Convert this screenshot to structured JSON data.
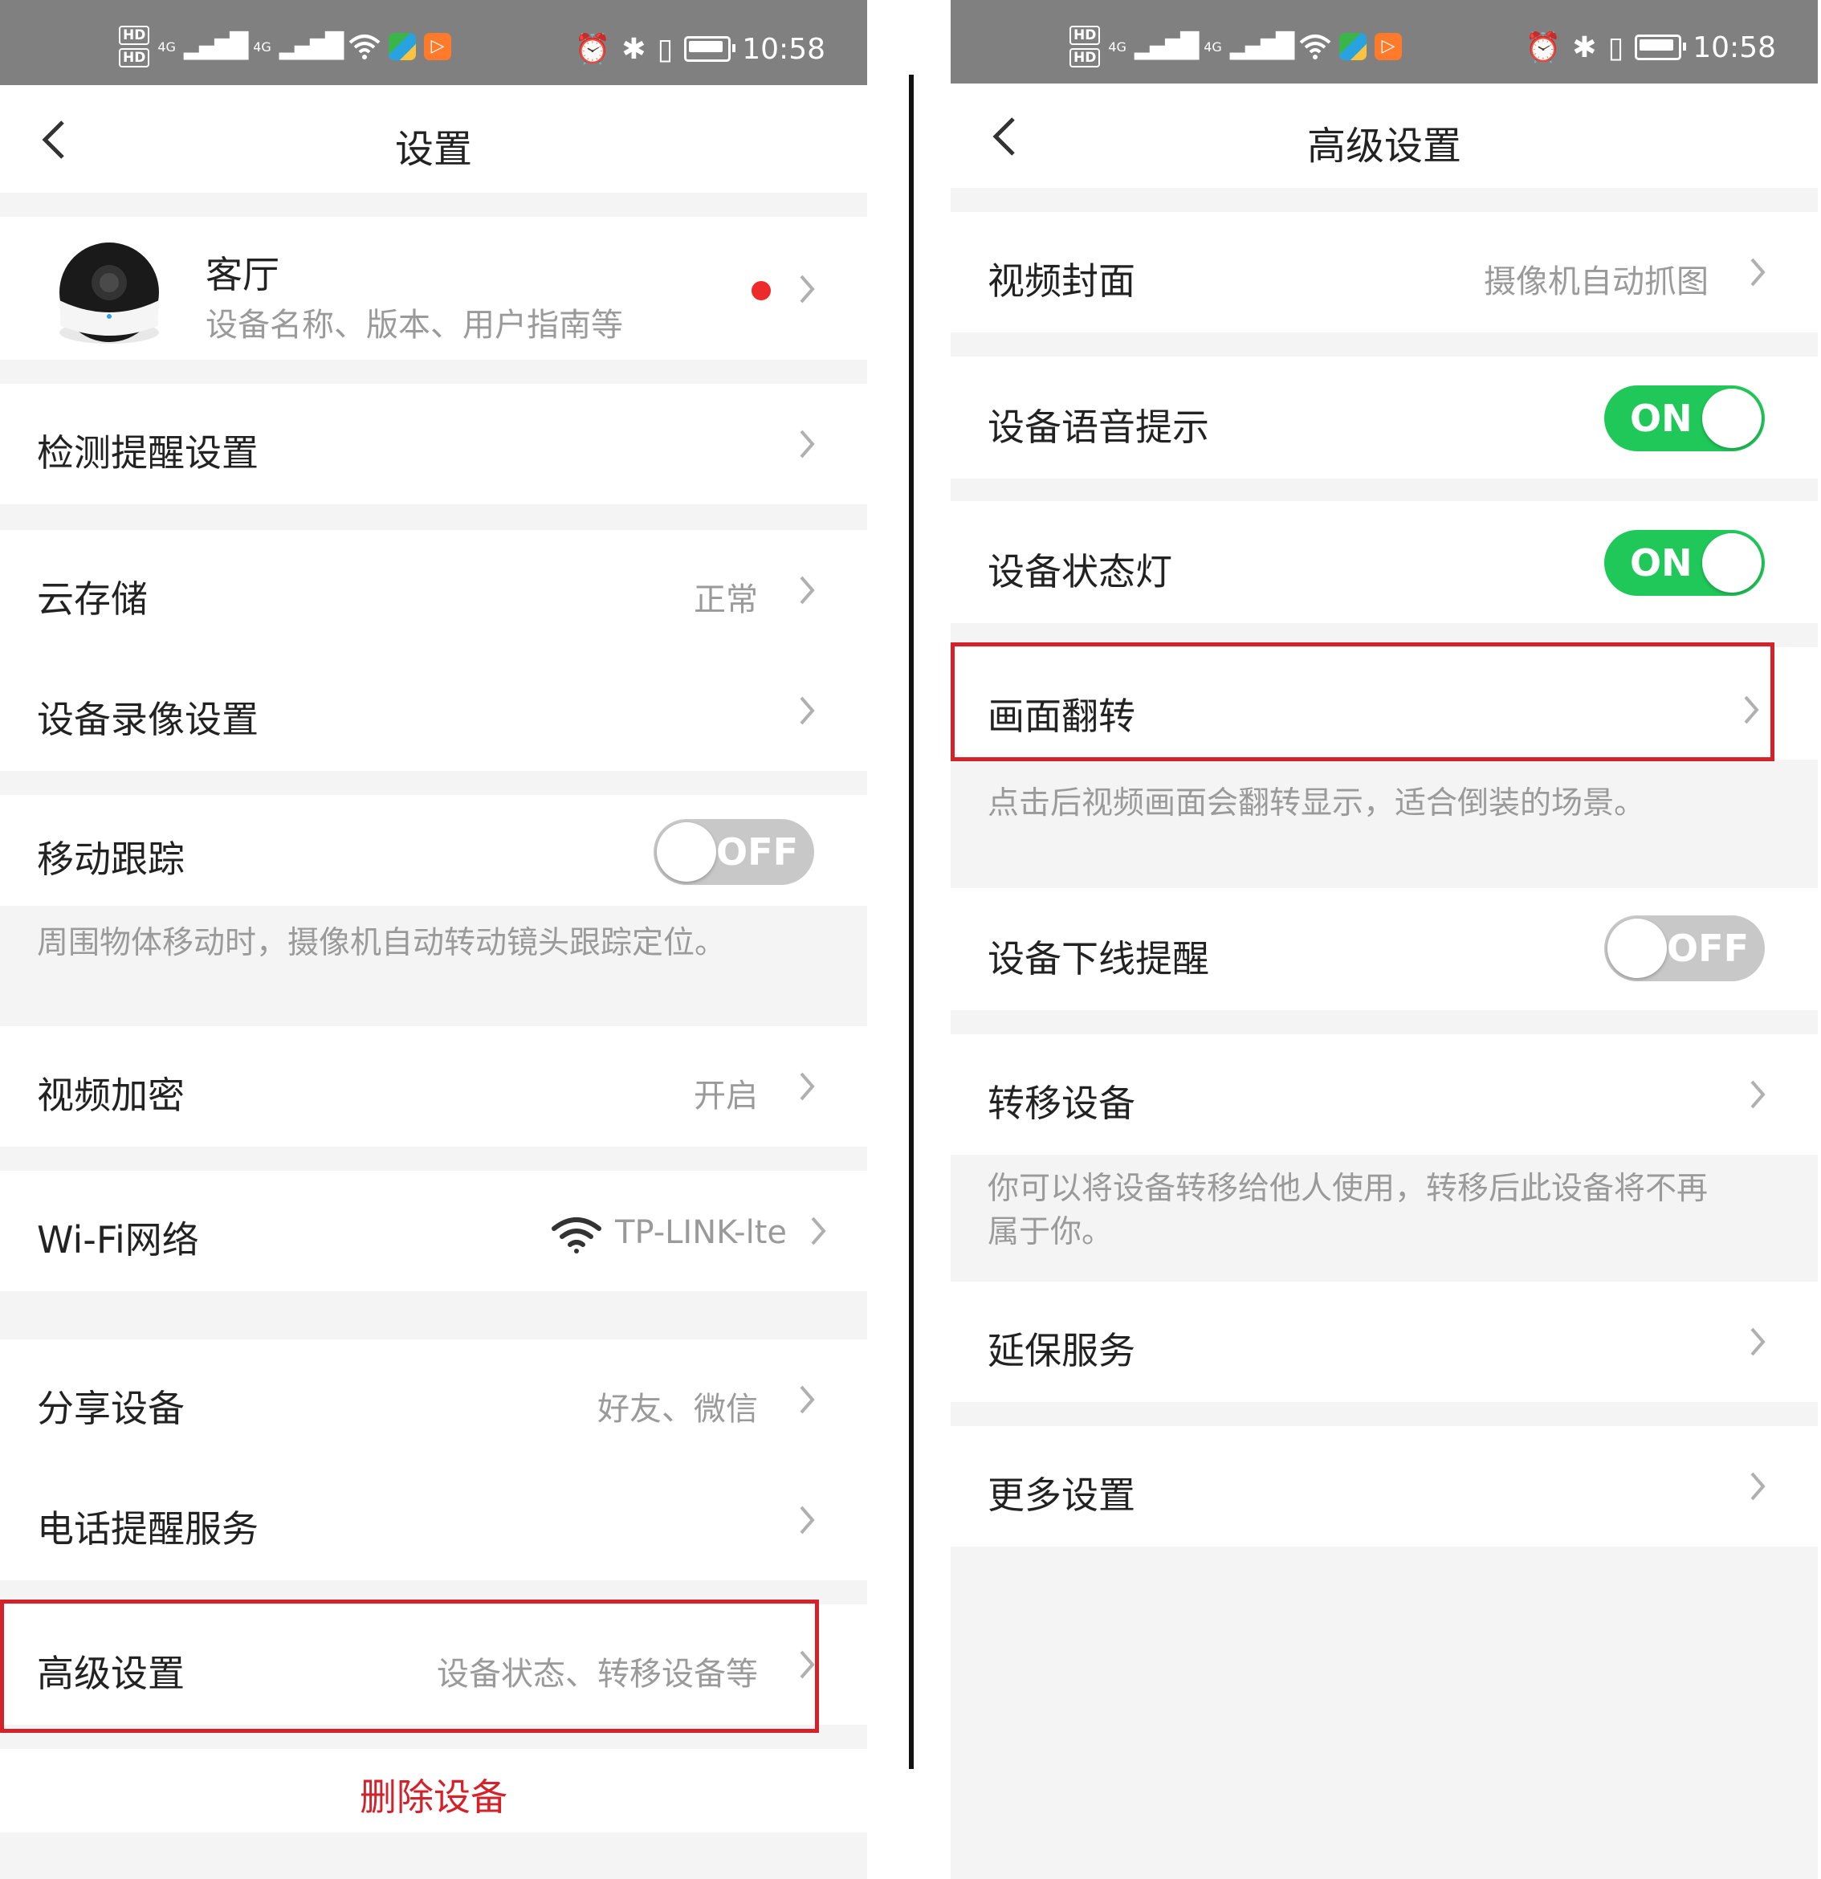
{
  "status_bar": {
    "hd1": "HD",
    "hd2": "HD",
    "net1": "4G",
    "net2": "4G",
    "time": "10:58"
  },
  "left": {
    "title": "设置",
    "device": {
      "name": "客厅",
      "subtitle": "设备名称、版本、用户指南等"
    },
    "items": {
      "detection": {
        "label": "检测提醒设置"
      },
      "cloud": {
        "label": "云存储",
        "value": "正常"
      },
      "recording": {
        "label": "设备录像设置"
      },
      "tracking": {
        "label": "移动跟踪",
        "toggle": "OFF",
        "hint": "周围物体移动时，摄像机自动转动镜头跟踪定位。"
      },
      "encryption": {
        "label": "视频加密",
        "value": "开启"
      },
      "wifi": {
        "label": "Wi-Fi网络",
        "value": "TP-LINK-lte"
      },
      "share": {
        "label": "分享设备",
        "value": "好友、微信"
      },
      "phone": {
        "label": "电话提醒服务"
      },
      "advanced": {
        "label": "高级设置",
        "value": "设备状态、转移设备等"
      }
    },
    "delete_label": "删除设备"
  },
  "right": {
    "title": "高级设置",
    "items": {
      "cover": {
        "label": "视频封面",
        "value": "摄像机自动抓图"
      },
      "voice": {
        "label": "设备语音提示",
        "toggle": "ON"
      },
      "light": {
        "label": "设备状态灯",
        "toggle": "ON"
      },
      "flip": {
        "label": "画面翻转",
        "hint": "点击后视频画面会翻转显示，适合倒装的场景。"
      },
      "offline": {
        "label": "设备下线提醒",
        "toggle": "OFF"
      },
      "transfer": {
        "label": "转移设备",
        "hint_line1": "你可以将设备转移给他人使用，转移后此设备将不再",
        "hint_line2": "属于你。"
      },
      "warranty": {
        "label": "延保服务"
      },
      "more": {
        "label": "更多设置"
      }
    }
  },
  "icons": {
    "back": "chevron-left-icon",
    "chevron": "chevron-right-icon",
    "wifi": "wifi-icon",
    "camera": "camera-thumbnail",
    "alarm": "alarm-icon",
    "bluetooth": "bluetooth-icon",
    "vibrate": "vibrate-icon",
    "battery": "battery-icon"
  },
  "colors": {
    "toggle_on": "#20c85a",
    "toggle_off": "#c8c8c8",
    "highlight": "#d3222a",
    "status_bar": "#808080",
    "delete": "#d3222a"
  }
}
